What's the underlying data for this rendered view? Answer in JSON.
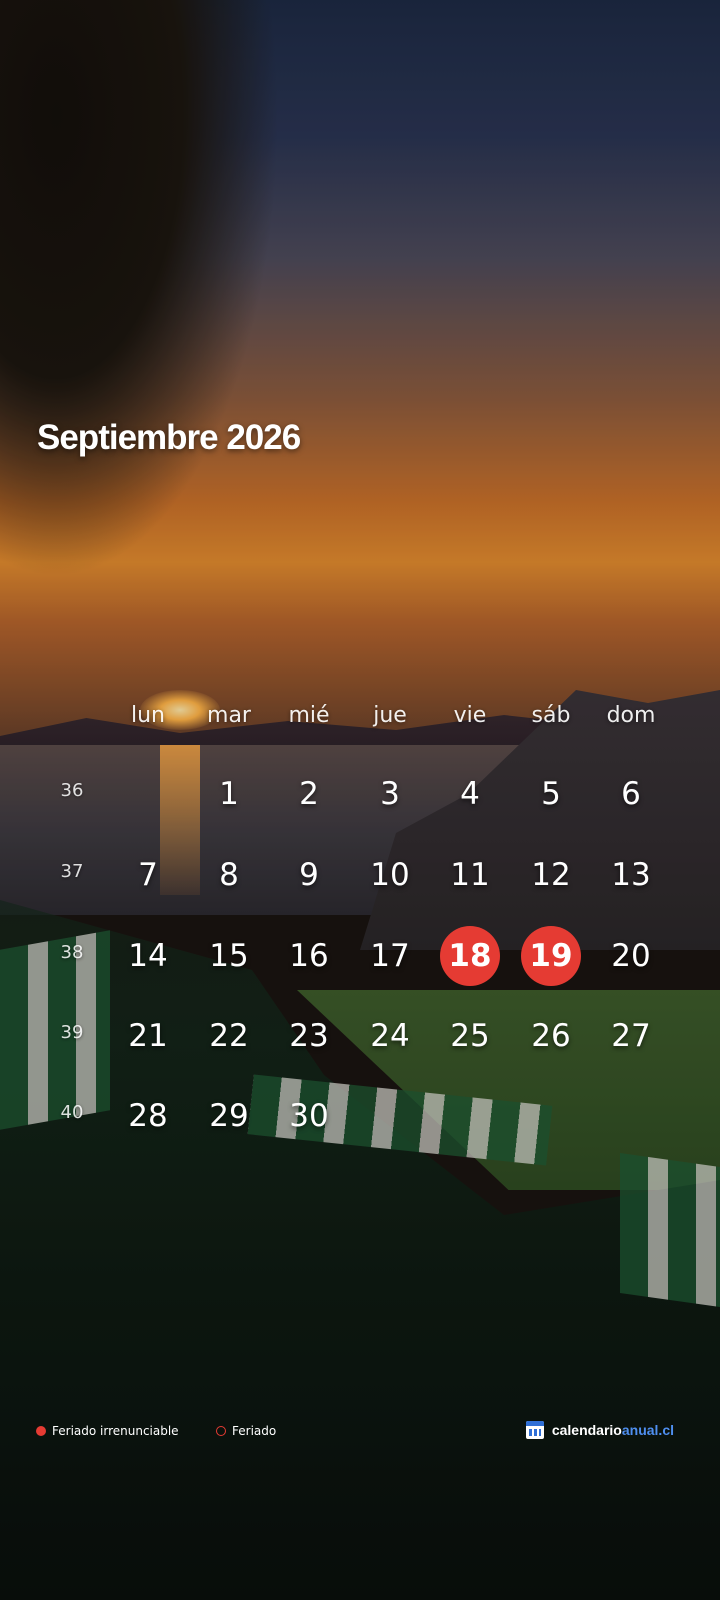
{
  "calendar": {
    "title": "Septiembre 2026",
    "weekdays": [
      "lun",
      "mar",
      "mié",
      "jue",
      "vie",
      "sáb",
      "dom"
    ],
    "weeks": [
      {
        "number": "36",
        "days": [
          "",
          "1",
          "2",
          "3",
          "4",
          "5",
          "6"
        ]
      },
      {
        "number": "37",
        "days": [
          "7",
          "8",
          "9",
          "10",
          "11",
          "12",
          "13"
        ]
      },
      {
        "number": "38",
        "days": [
          "14",
          "15",
          "16",
          "17",
          "18",
          "19",
          "20"
        ]
      },
      {
        "number": "39",
        "days": [
          "21",
          "22",
          "23",
          "24",
          "25",
          "26",
          "27"
        ]
      },
      {
        "number": "40",
        "days": [
          "28",
          "29",
          "30",
          "",
          "",
          "",
          ""
        ]
      }
    ],
    "holidays_irrenunciable": [
      "18",
      "19"
    ],
    "holiday_color": "#e53b33"
  },
  "legend": {
    "irrenunciable_label": "Feriado irrenunciable",
    "feriado_label": "Feriado"
  },
  "brand": {
    "name_part1": "calendario",
    "name_part2": "anual.cl",
    "icon": "calendar-icon",
    "accent_color": "#4f8ff0"
  }
}
